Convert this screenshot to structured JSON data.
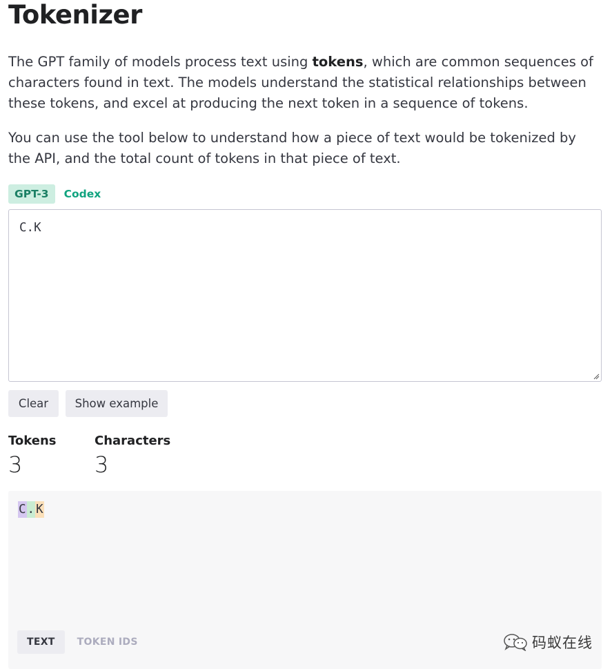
{
  "title": "Tokenizer",
  "intro": {
    "part1": "The GPT family of models process text using ",
    "bold": "tokens",
    "part2": ", which are common sequences of characters found in text. The models understand the statistical relationships between these tokens, and excel at producing the next token in a sequence of tokens."
  },
  "intro2": "You can use the tool below to understand how a piece of text would be tokenized by the API, and the total count of tokens in that piece of text.",
  "model_tabs": [
    {
      "label": "GPT-3",
      "active": true
    },
    {
      "label": "Codex",
      "active": false
    }
  ],
  "editor": {
    "value": "C.K"
  },
  "buttons": {
    "clear": "Clear",
    "show_example": "Show example"
  },
  "stats": {
    "tokens_label": "Tokens",
    "tokens_value": "3",
    "characters_label": "Characters",
    "characters_value": "3"
  },
  "output": {
    "tokens": [
      {
        "text": "C",
        "color": "#d5c7f0"
      },
      {
        "text": ".",
        "color": "#c9ecd2"
      },
      {
        "text": "K",
        "color": "#fbe0b9"
      }
    ],
    "view_tabs": [
      {
        "label": "TEXT",
        "active": true
      },
      {
        "label": "TOKEN IDS",
        "active": false
      }
    ]
  },
  "watermark": {
    "text": "码蚁在线",
    "icon": "wechat-icon"
  }
}
